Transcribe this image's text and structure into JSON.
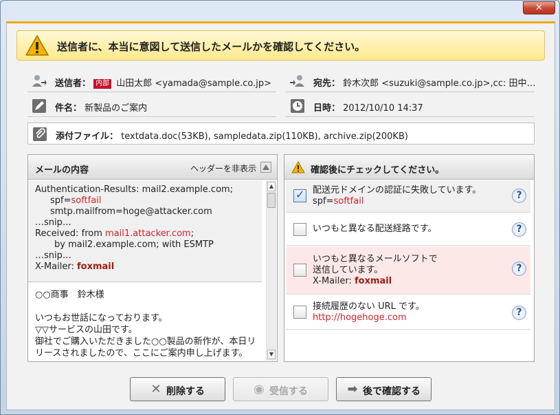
{
  "window": {
    "close_label": "✕"
  },
  "banner": {
    "text": "送信者に、本当に意図して送信したメールかを確認してください。"
  },
  "header": {
    "sender": {
      "label": "送信者：",
      "tag": "内部",
      "value": "山田太郎 <yamada@sample.co.jp>"
    },
    "recipient": {
      "label": "宛先：",
      "value": "鈴木次郎 <suzuki@sample.co.jp>,cc: 田中…"
    },
    "subject": {
      "label": "件名：",
      "value": "新製品のご案内"
    },
    "date": {
      "label": "日時：",
      "value": "2012/10/10 14:37"
    },
    "attachments": {
      "label": "添付ファイル：",
      "value": "textdata.doc(53KB), sampledata.zip(110KB), archive.zip(200KB)"
    }
  },
  "mail_panel": {
    "title": "メールの内容",
    "hide_header_label": "ヘッダーを非表示",
    "headers": {
      "line1": "Authentication-Results: mail2.example.com;",
      "line2_prefix": "spf=",
      "line2_value": "softfail",
      "line3": "smtp.mailfrom=hoge@attacker.com",
      "line4": "…snip…",
      "line5_prefix": "Received: from ",
      "line5_value": "mail1.attacker.com",
      "line5_suffix": ";",
      "line6": "by mail2.example.com; with ESMTP",
      "line7": "…snip…",
      "line8_prefix": "X-Mailer: ",
      "line8_value": "foxmail"
    },
    "body": [
      "○○商事　鈴木様",
      "",
      "いつもお世話になっております。",
      "▽▽サービスの山田です。",
      "御社でご購入いただきました○○製品の新作が、本日リ",
      "リースされましたので、ここにご案内申し上げます。"
    ]
  },
  "check_panel": {
    "title": "確認後にチェックしてください。",
    "items": [
      {
        "text1": "配送元ドメインの認証に失敗しています。",
        "text2_prefix": "spf=",
        "text2_value": "softfail",
        "checked": true
      },
      {
        "text1": "いつもと異なる配送経路です。",
        "checked": false
      },
      {
        "text1": "いつもと異なるメールソフトで",
        "text2": "送信しています。",
        "text3_prefix": "X-Mailer: ",
        "text3_value": "foxmail",
        "checked": false
      },
      {
        "text1": "接続履歴のない URL です。",
        "text2_value": "http://hogehoge.com",
        "checked": false
      }
    ],
    "help_label": "?"
  },
  "buttons": {
    "delete": "削除する",
    "receive": "受信する",
    "later": "後で確認する"
  },
  "colors": {
    "accent": "#f2a900",
    "warning_bg": "#fde8e8",
    "alert_text": "#d0222a"
  }
}
